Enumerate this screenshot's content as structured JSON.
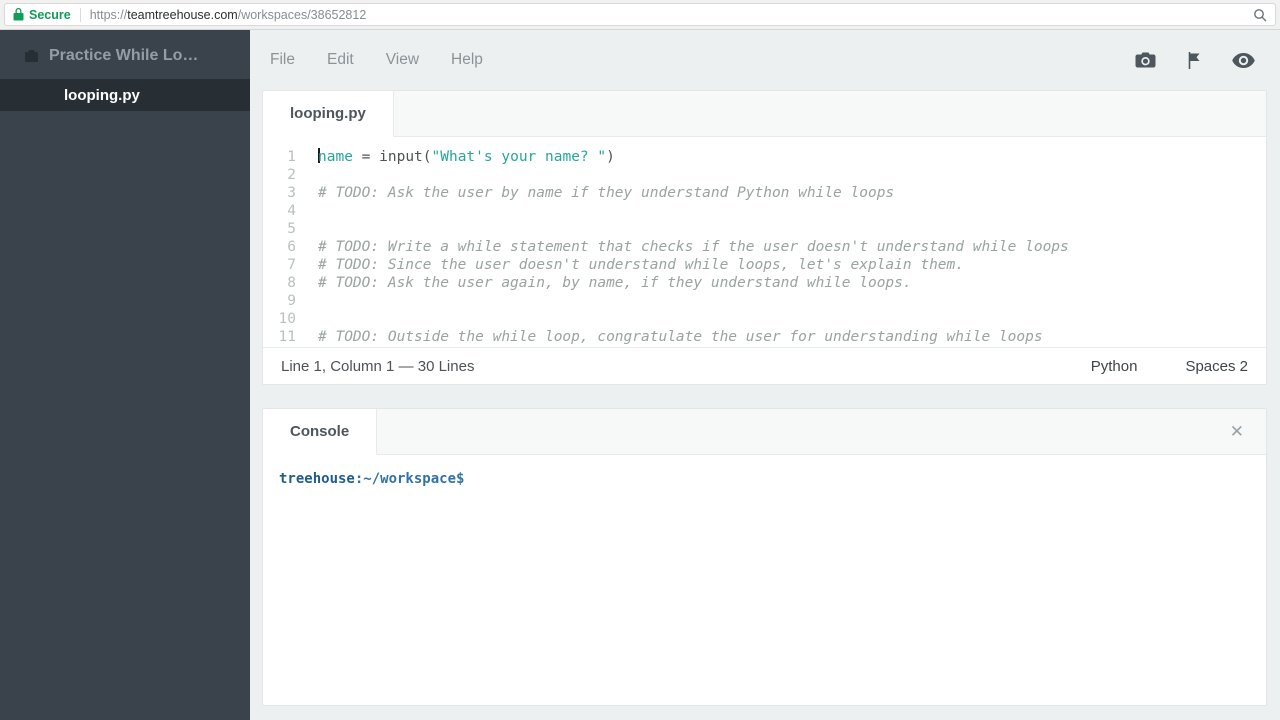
{
  "browser": {
    "secure_label": "Secure",
    "url": {
      "scheme": "https://",
      "domain": "teamtreehouse.com",
      "path": "/workspaces/38652812"
    }
  },
  "sidebar": {
    "project_name": "Practice While Lo…",
    "files": [
      {
        "name": "looping.py"
      }
    ]
  },
  "menubar": {
    "items": [
      "File",
      "Edit",
      "View",
      "Help"
    ]
  },
  "editor": {
    "tab_label": "looping.py",
    "cursor_line": "1",
    "lines": [
      {
        "n": "1",
        "parts": [
          {
            "t": "name",
            "c": "var"
          },
          {
            "t": " = ",
            "c": "plain"
          },
          {
            "t": "input",
            "c": "plain"
          },
          {
            "t": "(",
            "c": "plain"
          },
          {
            "t": "\"What's your name? \"",
            "c": "str"
          },
          {
            "t": ")",
            "c": "plain"
          }
        ]
      },
      {
        "n": "2",
        "parts": []
      },
      {
        "n": "3",
        "parts": [
          {
            "t": "# TODO: Ask the user by name if they understand Python while loops",
            "c": "comment"
          }
        ]
      },
      {
        "n": "4",
        "parts": []
      },
      {
        "n": "5",
        "parts": []
      },
      {
        "n": "6",
        "parts": [
          {
            "t": "# TODO: Write a while statement that checks if the user doesn't understand while loops",
            "c": "comment"
          }
        ]
      },
      {
        "n": "7",
        "parts": [
          {
            "t": "# TODO: Since the user doesn't understand while loops, let's explain them.",
            "c": "comment"
          }
        ]
      },
      {
        "n": "8",
        "parts": [
          {
            "t": "# TODO: Ask the user again, by name, if they understand while loops.",
            "c": "comment"
          }
        ]
      },
      {
        "n": "9",
        "parts": []
      },
      {
        "n": "10",
        "parts": []
      },
      {
        "n": "11",
        "parts": [
          {
            "t": "# TODO: Outside the while loop, congratulate the user for understanding while loops",
            "c": "comment"
          }
        ]
      }
    ],
    "status": {
      "position": "Line 1, Column 1 — 30 Lines",
      "language": "Python",
      "indent": "Spaces 2"
    }
  },
  "console": {
    "tab_label": "Console",
    "close_glyph": "✕",
    "prompt_user": "treehouse",
    "prompt_rest": ":~/workspace$"
  },
  "colors": {
    "accent_teal": "#26a69a",
    "secure_green": "#0f9d58",
    "sidebar_bg": "#3a434b",
    "sidebar_active_bg": "#272e34",
    "comment_gray": "#9aa2a2",
    "prompt_user_blue": "#1f5d8a",
    "prompt_path_blue": "#3173a9"
  }
}
